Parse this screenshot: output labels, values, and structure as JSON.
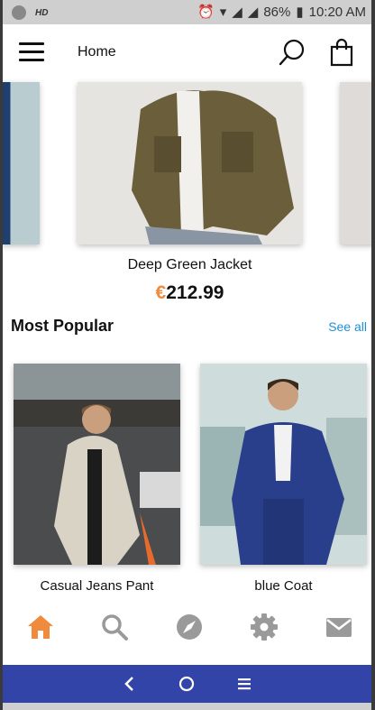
{
  "status_bar": {
    "hd_label": "HD",
    "battery": "86%",
    "time": "10:20 AM"
  },
  "app_bar": {
    "title": "Home"
  },
  "featured": {
    "name": "Deep Green Jacket",
    "currency": "€",
    "amount": "212.99"
  },
  "most_popular": {
    "title": "Most Popular",
    "see_all": "See all",
    "items": [
      {
        "name": "Casual Jeans Pant"
      },
      {
        "name": "blue Coat"
      }
    ]
  },
  "tabs": [
    {
      "icon": "home-icon",
      "active": true
    },
    {
      "icon": "search-icon"
    },
    {
      "icon": "compass-icon"
    },
    {
      "icon": "gear-icon"
    },
    {
      "icon": "mail-icon"
    }
  ],
  "colors": {
    "accent": "#f08a3c",
    "link": "#1f8fd6",
    "navbar": "#3344a8",
    "inactive_icon": "#9a9a9a"
  }
}
